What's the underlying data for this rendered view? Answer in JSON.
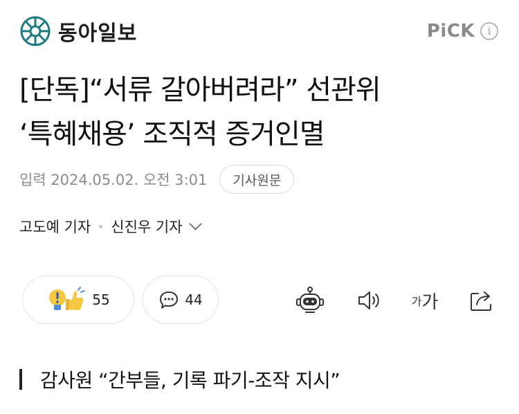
{
  "header": {
    "logo_text": "동아일보",
    "pick_label": "PiCK",
    "info_glyph": "i"
  },
  "article": {
    "headline_line1": "[단독]“서류 갈아버려라” 선관위",
    "headline_line2": "‘특혜채용’ 조직적 증거인멸",
    "date": "입력 2024.05.02. 오전 3:01",
    "original_button": "기사원문",
    "reporter1": "고도예 기자",
    "reporter2": "신진우 기자",
    "subheading": "감사원 “간부들, 기록 파기-조작 지시”"
  },
  "actions": {
    "reaction_count": "55",
    "comment_count": "44",
    "font_small": "가",
    "font_large": "가"
  },
  "icons": {
    "logo": "dong-a-emblem-icon",
    "reaction": "lightbulb-thumbs-up-icon",
    "comment": "speech-bubble-icon",
    "bot": "robot-summary-icon",
    "sound": "speaker-icon",
    "share": "share-icon"
  },
  "colors": {
    "logo_teal": "#1d7a80",
    "pick_gray": "#8a8a8a",
    "reaction_yellow": "#f5c842",
    "reaction_blue": "#4a8fd8"
  }
}
